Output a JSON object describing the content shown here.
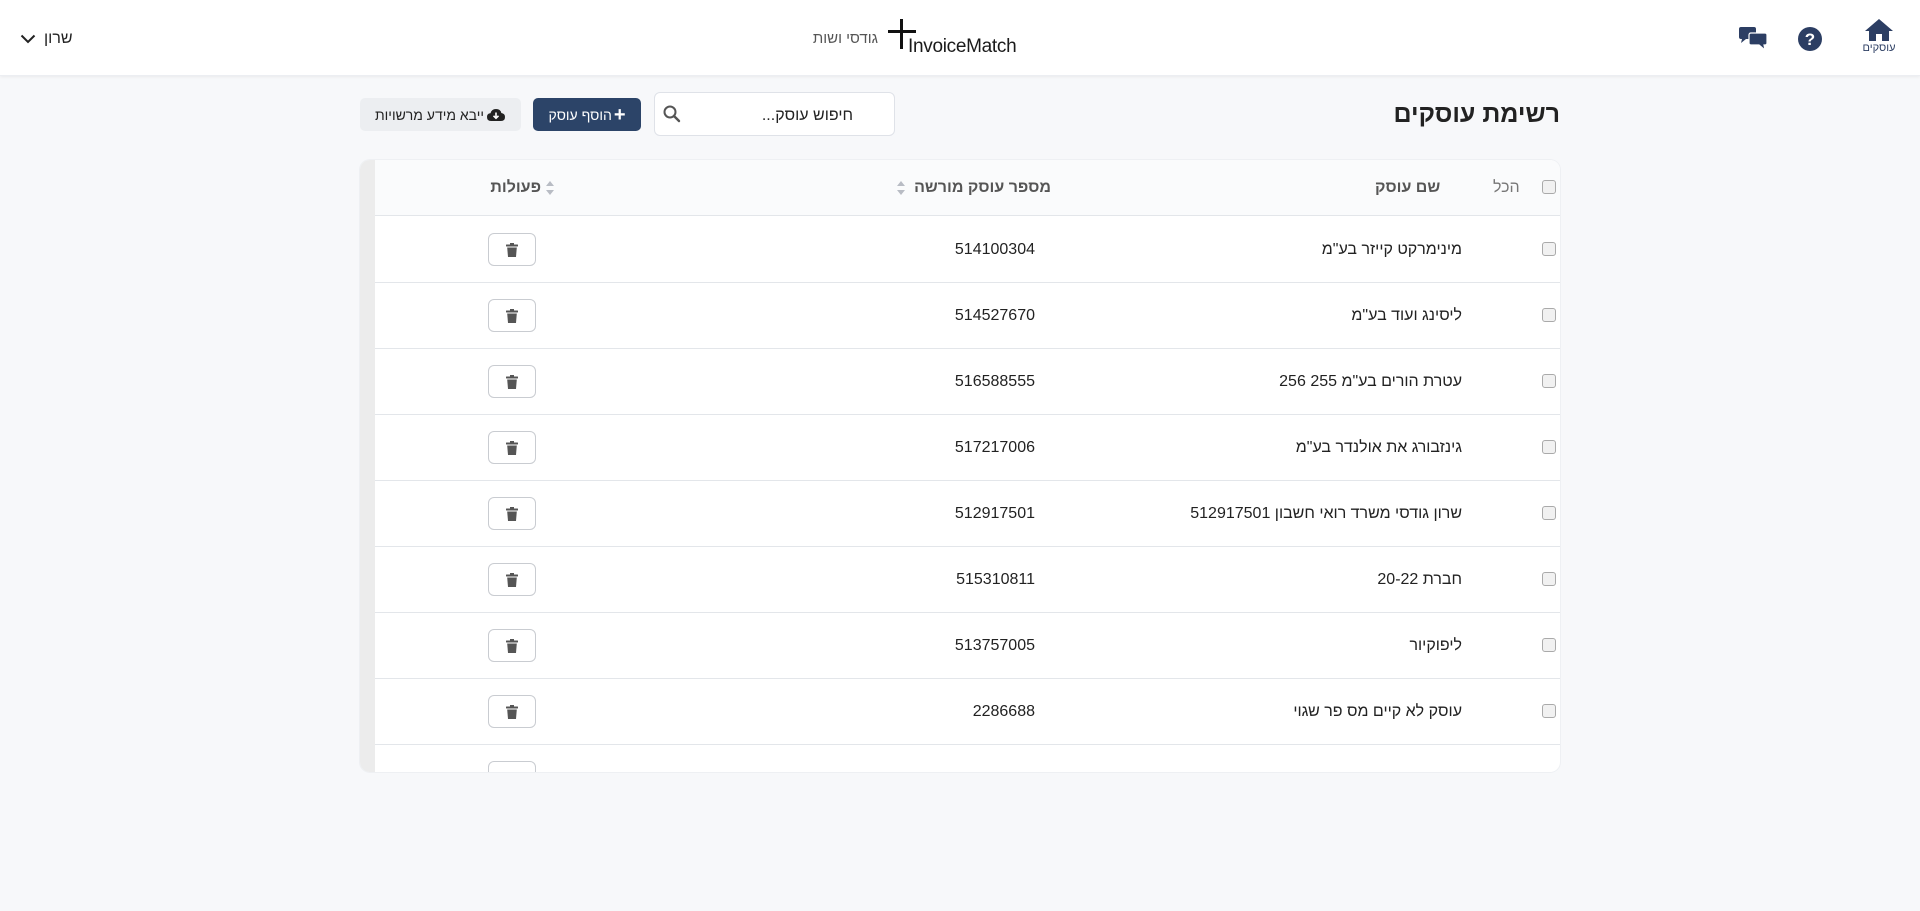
{
  "header": {
    "home_label": "עוסקים",
    "company_name": "גודסי ושות",
    "logo_text": "InvoiceMatch",
    "user_name": "שרון",
    "accent_color": "#2c4468",
    "icons": {
      "home": "home-icon",
      "help": "help-circle-icon",
      "chat": "chat-bubbles-icon",
      "user_menu": "chevron-down-icon"
    }
  },
  "toolbar": {
    "page_title": "רשימת עוסקים",
    "search_placeholder": "חיפוש עוסק...",
    "add_label": "הוסף עוסק",
    "import_label": "ייבא מידע מרשויות"
  },
  "table": {
    "select_all_label": "הכל",
    "columns": {
      "name": "שם עוסק",
      "number": "מספר עוסק מורשה",
      "actions": "פעולות"
    },
    "rows": [
      {
        "name": "מינימרקט קייזר בע\"מ",
        "number": "514100304"
      },
      {
        "name": "ליסינג ועוד בע\"מ",
        "number": "514527670"
      },
      {
        "name": "עטרת הורים בע\"מ 255 256",
        "number": "516588555"
      },
      {
        "name": "גינזבורג את אולנדר בע\"מ",
        "number": "517217006"
      },
      {
        "name": "שרון גודסי משרד רואי חשבון 512917501",
        "number": "512917501"
      },
      {
        "name": "חברת 20-22",
        "number": "515310811"
      },
      {
        "name": "ליפוקיור",
        "number": "513757005"
      },
      {
        "name": "עוסק לא קיים מס פר שגוי",
        "number": "2286688"
      }
    ]
  }
}
